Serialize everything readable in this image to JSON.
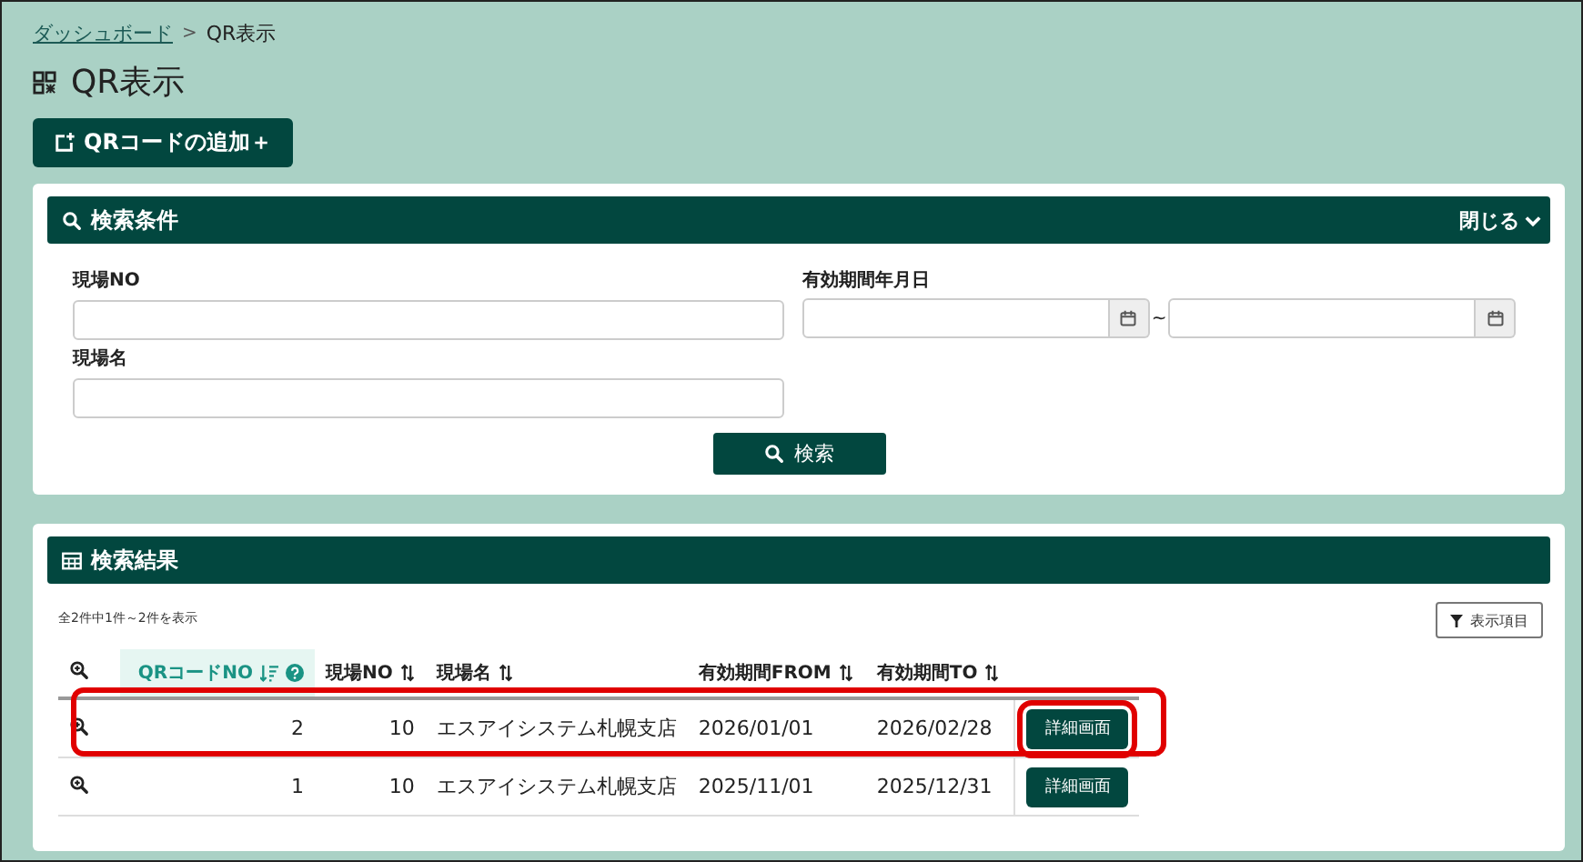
{
  "breadcrumb": [
    {
      "label": "ダッシュボード",
      "kind": "link"
    },
    {
      "label": "QR表示",
      "kind": "current"
    }
  ],
  "breadcrumb_separator": ">",
  "page_title": "QR表示",
  "add_button": "QRコードの追加＋",
  "search_panel": {
    "title": "検索条件",
    "toggle": "閉じる",
    "expanded": true,
    "fields": {
      "site_no": {
        "label": "現場NO"
      },
      "site_name": {
        "label": "現場名"
      },
      "period": {
        "label": "有効期間年月日",
        "separator": "~"
      }
    },
    "search_button": "検索"
  },
  "results_panel": {
    "title": "検索結果",
    "summary": "全2件中1件～2件を表示",
    "columns_button": "表示項目",
    "columns": [
      {
        "label": "QRコードNO",
        "selected": true,
        "kind": "number"
      },
      {
        "label": "現場NO",
        "selected": false,
        "kind": "number"
      },
      {
        "label": "現場名",
        "selected": false,
        "kind": "text"
      },
      {
        "label": "有効期間FROM",
        "selected": false,
        "kind": "text"
      },
      {
        "label": "有効期間TO",
        "selected": false,
        "kind": "text"
      }
    ],
    "rows": [
      {
        "cells": [
          "2",
          "10",
          "エスアイシステム札幌支店",
          "2026/01/01",
          "2026/02/28"
        ],
        "action": "詳細画面",
        "highlighted": true
      },
      {
        "cells": [
          "1",
          "10",
          "エスアイシステム札幌支店",
          "2025/11/01",
          "2025/12/31"
        ],
        "action": "詳細画面",
        "highlighted": false
      }
    ]
  }
}
